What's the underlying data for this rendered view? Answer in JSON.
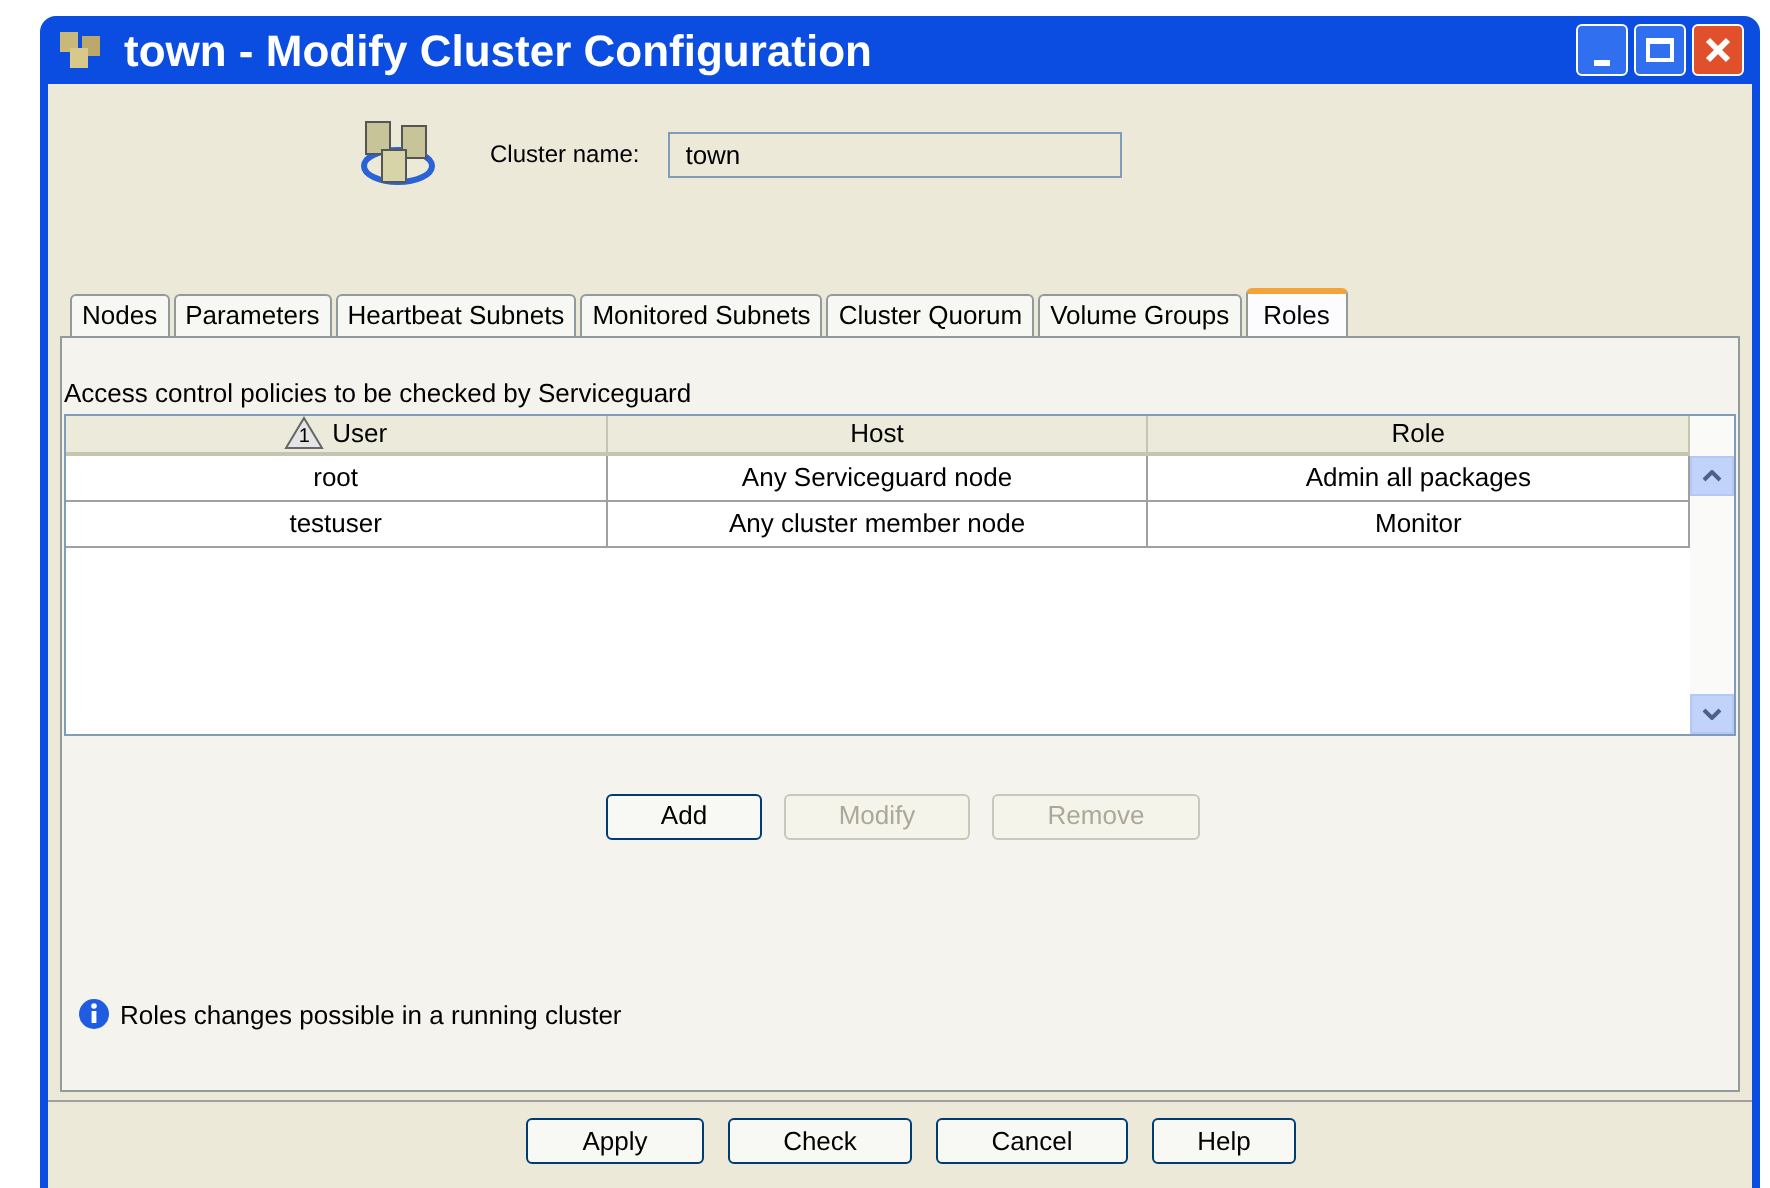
{
  "window": {
    "title": "town - Modify Cluster Configuration"
  },
  "cluster_name": {
    "label": "Cluster name:",
    "value": "town"
  },
  "tabs": [
    {
      "label": "Nodes",
      "selected": false
    },
    {
      "label": "Parameters",
      "selected": false
    },
    {
      "label": "Heartbeat Subnets",
      "selected": false
    },
    {
      "label": "Monitored Subnets",
      "selected": false
    },
    {
      "label": "Cluster Quorum",
      "selected": false
    },
    {
      "label": "Volume Groups",
      "selected": false
    },
    {
      "label": "Roles",
      "selected": true
    }
  ],
  "caption": "Access control policies to be checked by Serviceguard",
  "table": {
    "columns": [
      {
        "label": "User",
        "sort_rank": "1"
      },
      {
        "label": "Host"
      },
      {
        "label": "Role"
      }
    ],
    "rows": [
      [
        "root",
        "Any Serviceguard node",
        "Admin all packages"
      ],
      [
        "testuser",
        "Any cluster member node",
        "Monitor"
      ]
    ]
  },
  "row_buttons": [
    {
      "label": "Add",
      "disabled": false
    },
    {
      "label": "Modify",
      "disabled": true
    },
    {
      "label": "Remove",
      "disabled": true
    }
  ],
  "info": "Roles changes possible in a running cluster",
  "dialog_buttons": [
    "Apply",
    "Check",
    "Cancel",
    "Help"
  ]
}
